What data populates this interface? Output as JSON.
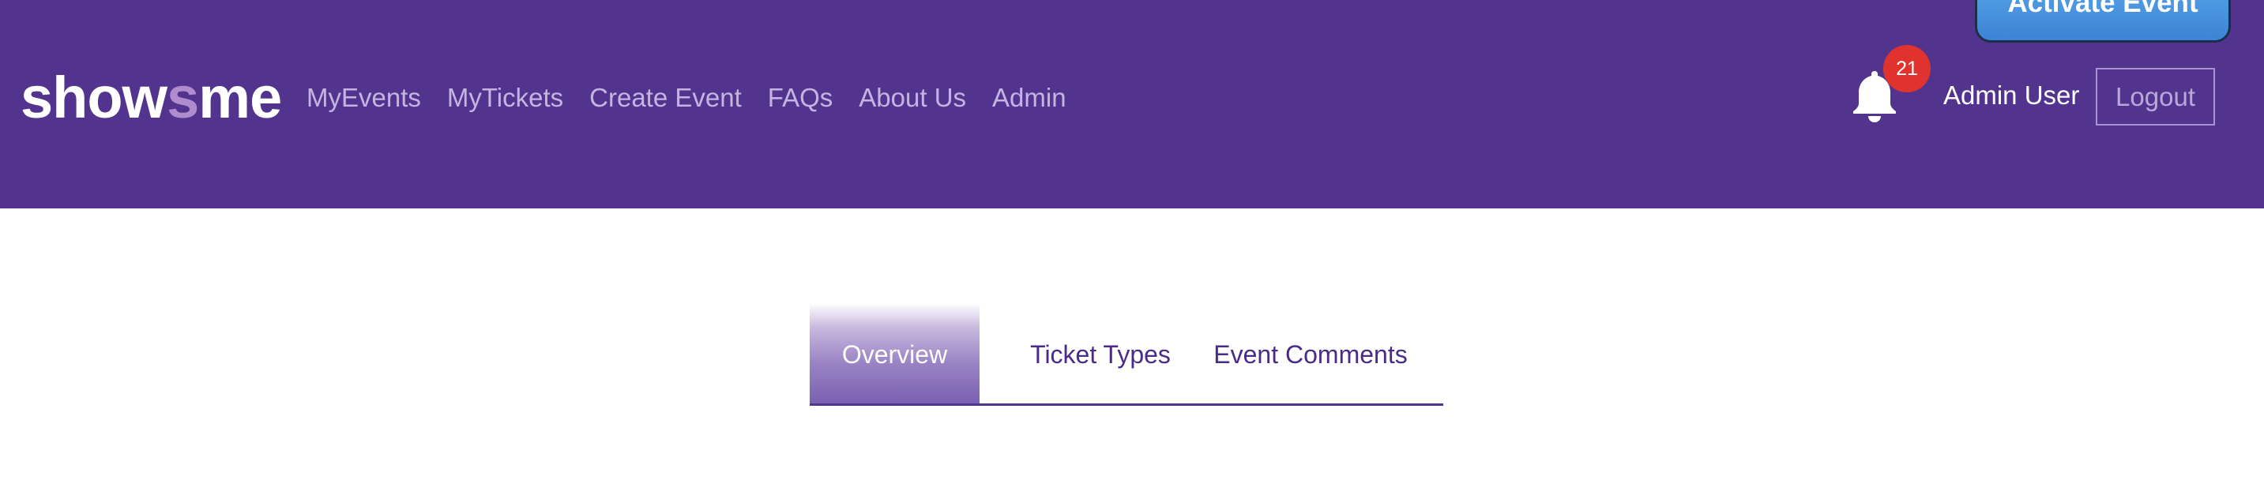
{
  "brand": {
    "part1": "show",
    "part2": "s",
    "part3": "me"
  },
  "nav": {
    "links": [
      "MyEvents",
      "MyTickets",
      "Create Event",
      "FAQs",
      "About Us",
      "Admin"
    ]
  },
  "notifications": {
    "count": "21",
    "icon": "bell-icon"
  },
  "user": {
    "name": "Admin User",
    "logout_label": "Logout"
  },
  "actions": {
    "activate_label": "Activate Event"
  },
  "tabs": [
    {
      "label": "Overview",
      "active": true
    },
    {
      "label": "Ticket Types",
      "active": false
    },
    {
      "label": "Event Comments",
      "active": false
    }
  ],
  "colors": {
    "navbar": "#52348f",
    "badge": "#e0332e",
    "activate_button": "#4a95e0"
  }
}
